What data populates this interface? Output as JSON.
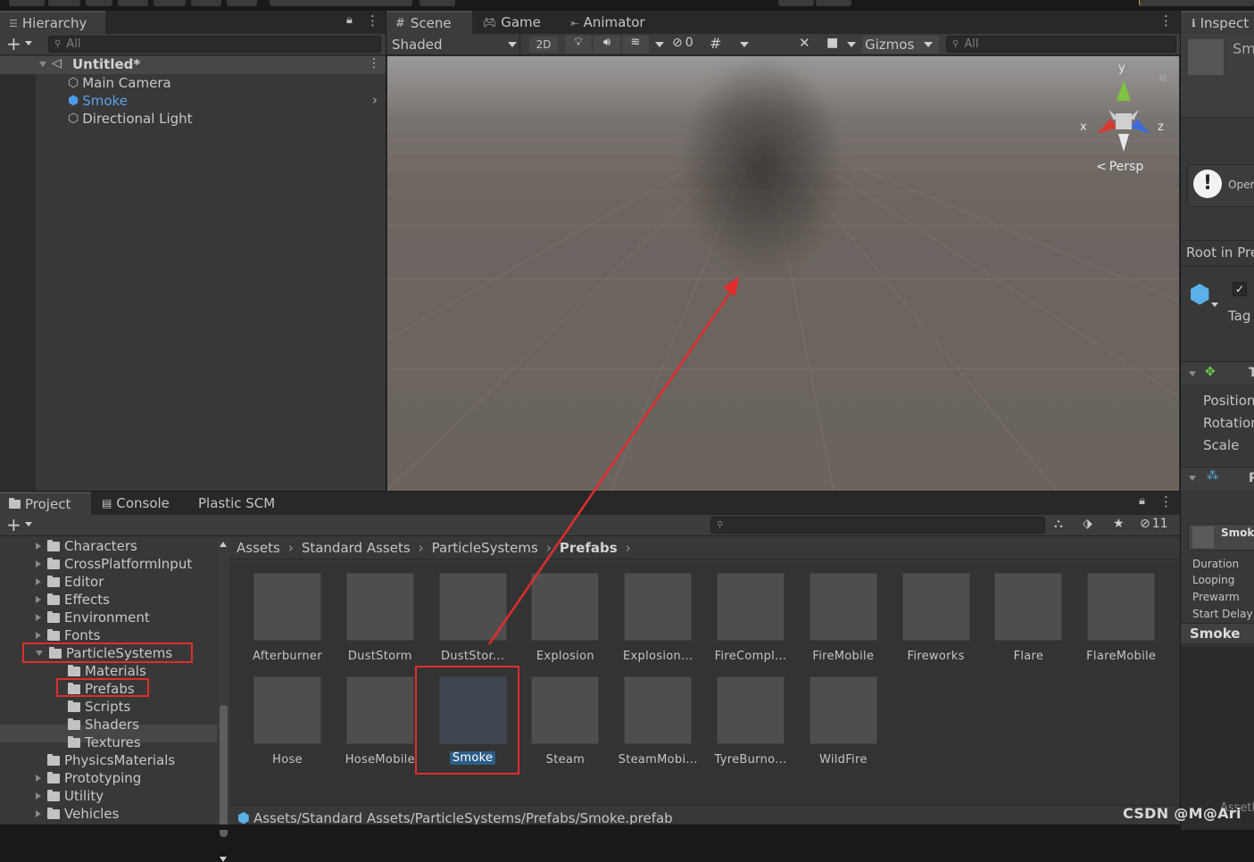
{
  "hierarchy": {
    "tab_label": "Hierarchy",
    "search_placeholder": "All",
    "scene_name": "Untitled*",
    "items": [
      {
        "label": "Main Camera"
      },
      {
        "label": "Smoke"
      },
      {
        "label": "Directional Light"
      }
    ]
  },
  "scene": {
    "tabs": [
      {
        "label": "Scene"
      },
      {
        "label": "Game"
      },
      {
        "label": "Animator"
      }
    ],
    "shading_mode": "Shaded",
    "toggle_2d": "2D",
    "hidden_count": "0",
    "gizmos_label": "Gizmos",
    "search_placeholder": "All",
    "projection_label": "Persp",
    "axis_y": "y",
    "axis_x": "x",
    "axis_z": "z"
  },
  "inspector": {
    "tab_label": "Inspect",
    "object_name_partial": "Sm",
    "open_label": "Oper",
    "root_in_prefab": "Root in Pre",
    "tag_label": "Tag",
    "transform_header": "T",
    "position_label": "Position",
    "rotation_label": "Rotation",
    "scale_label": "Scale",
    "particle_header": "P",
    "particle_name": "Smok",
    "duration_label": "Duration",
    "looping_label": "Looping",
    "prewarm_label": "Prewarm",
    "start_delay_label": "Start Delay",
    "smoke_header": "Smoke",
    "assetbundle_label": "AssetBund"
  },
  "project": {
    "tabs": [
      {
        "label": "Project"
      },
      {
        "label": "Console"
      },
      {
        "label": "Plastic SCM"
      }
    ],
    "hidden_count": "11",
    "folders": [
      {
        "label": "Characters"
      },
      {
        "label": "CrossPlatformInput"
      },
      {
        "label": "Editor"
      },
      {
        "label": "Effects"
      },
      {
        "label": "Environment"
      },
      {
        "label": "Fonts"
      },
      {
        "label": "ParticleSystems"
      },
      {
        "label": "Materials"
      },
      {
        "label": "Prefabs"
      },
      {
        "label": "Scripts"
      },
      {
        "label": "Shaders"
      },
      {
        "label": "Textures"
      },
      {
        "label": "PhysicsMaterials"
      },
      {
        "label": "Prototyping"
      },
      {
        "label": "Utility"
      },
      {
        "label": "Vehicles"
      }
    ],
    "breadcrumb": [
      "Assets",
      "Standard Assets",
      "ParticleSystems",
      "Prefabs"
    ],
    "assets": [
      {
        "label": "Afterburner"
      },
      {
        "label": "DustStorm"
      },
      {
        "label": "DustStor..."
      },
      {
        "label": "Explosion"
      },
      {
        "label": "Explosion..."
      },
      {
        "label": "FireCompl..."
      },
      {
        "label": "FireMobile"
      },
      {
        "label": "Fireworks"
      },
      {
        "label": "Flare"
      },
      {
        "label": "FlareMobile"
      },
      {
        "label": "Hose"
      },
      {
        "label": "HoseMobile"
      },
      {
        "label": "Smoke"
      },
      {
        "label": "Steam"
      },
      {
        "label": "SteamMobi..."
      },
      {
        "label": "TyreBurno..."
      },
      {
        "label": "WildFire"
      }
    ],
    "selected_asset": "Smoke",
    "status_path": "Assets/Standard Assets/ParticleSystems/Prefabs/Smoke.prefab"
  },
  "watermark": "CSDN @M@Ari",
  "colors": {
    "accent_blue": "#4c8fd6",
    "selection": "#2c5d87",
    "annotation_red": "#e02d2d"
  }
}
